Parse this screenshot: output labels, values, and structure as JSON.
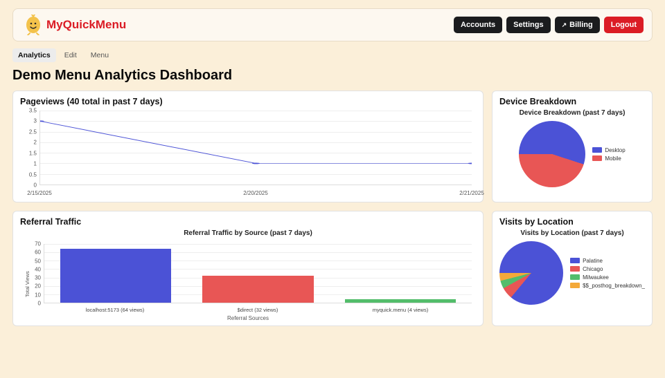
{
  "brand": {
    "name": "MyQuickMenu"
  },
  "header": {
    "accounts": "Accounts",
    "settings": "Settings",
    "billing": "Billing",
    "logout": "Logout"
  },
  "tabs": {
    "analytics": "Analytics",
    "edit": "Edit",
    "menu": "Menu"
  },
  "page_title": "Demo Menu Analytics Dashboard",
  "pageviews": {
    "title": "Pageviews (40 total in past 7 days)"
  },
  "referral": {
    "title": "Referral Traffic",
    "chart_title": "Referral Traffic by Source (past 7 days)",
    "ylabel": "Total Views",
    "xlabel": "Referral Sources"
  },
  "device": {
    "title": "Device Breakdown",
    "chart_title": "Device Breakdown (past 7 days)"
  },
  "location": {
    "title": "Visits by Location",
    "chart_title": "Visits by Location (past 7 days)"
  },
  "colors": {
    "blue": "#4b52d6",
    "red": "#e85655",
    "green": "#53bd6b",
    "orange": "#f4a939"
  },
  "chart_data": [
    {
      "id": "pageviews_line",
      "type": "line",
      "title": "Pageviews (40 total in past 7 days)",
      "x_ticks": [
        "2/15/2025",
        "2/20/2025",
        "2/21/2025"
      ],
      "y_ticks": [
        0,
        0.5,
        1.0,
        1.5,
        2.0,
        2.5,
        3.0,
        3.5
      ],
      "ylim": [
        0,
        3.5
      ],
      "series": [
        {
          "name": "Pageviews",
          "x": [
            "2/15/2025",
            "2/20/2025",
            "2/21/2025"
          ],
          "values": [
            3.0,
            1.0,
            1.0
          ],
          "color": "#4b52d6"
        }
      ]
    },
    {
      "id": "referral_bar",
      "type": "bar",
      "title": "Referral Traffic by Source (past 7 days)",
      "xlabel": "Referral Sources",
      "ylabel": "Total Views",
      "y_ticks": [
        0,
        10,
        20,
        30,
        40,
        50,
        60,
        70
      ],
      "ylim": [
        0,
        70
      ],
      "categories": [
        "localhost:5173 (64 views)",
        "$direct (32 views)",
        "myquick.menu (4 views)"
      ],
      "values": [
        64,
        32,
        4
      ],
      "colors": [
        "#4b52d6",
        "#e85655",
        "#53bd6b"
      ]
    },
    {
      "id": "device_pie",
      "type": "pie",
      "title": "Device Breakdown (past 7 days)",
      "slices": [
        {
          "label": "Desktop",
          "value": 55,
          "color": "#4b52d6"
        },
        {
          "label": "Mobile",
          "value": 45,
          "color": "#e85655"
        }
      ]
    },
    {
      "id": "location_pie",
      "type": "pie",
      "title": "Visits by Location (past 7 days)",
      "slices": [
        {
          "label": "Palatine",
          "value": 86,
          "color": "#4b52d6"
        },
        {
          "label": "Chicago",
          "value": 6,
          "color": "#e85655"
        },
        {
          "label": "Milwaukee",
          "value": 4,
          "color": "#53bd6b"
        },
        {
          "label": "$$_posthog_breakdown_",
          "value": 4,
          "color": "#f4a939"
        }
      ]
    }
  ]
}
